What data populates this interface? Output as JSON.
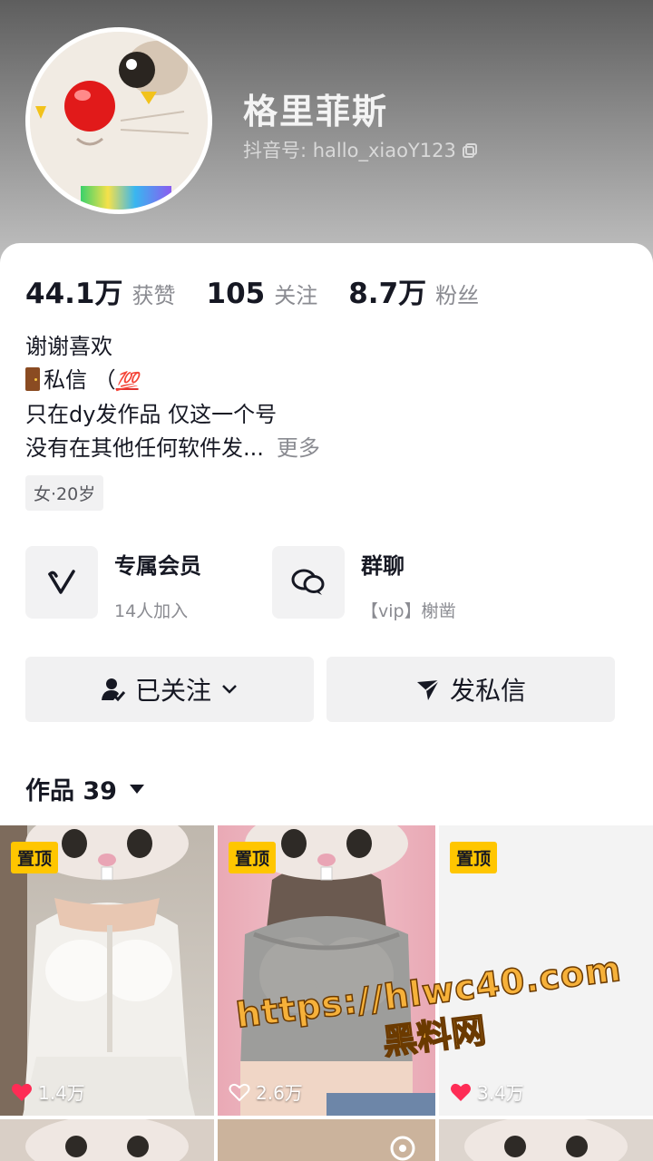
{
  "profile": {
    "nickname": "格里菲斯",
    "douyin_id": "抖音号: hallo_xiaoY123"
  },
  "stats": [
    {
      "value": "44.1万",
      "label": "获赞"
    },
    {
      "value": "105",
      "label": "关注"
    },
    {
      "value": "8.7万",
      "label": "粉丝"
    }
  ],
  "bio": {
    "line1": "谢谢喜欢",
    "line2_text": "私信 （",
    "line2_emoji": "💯",
    "line3": "只在dy发作品  仅这一个号",
    "line4": "没有在其他任何软件发...",
    "more": "更多"
  },
  "tag": "女·20岁",
  "features": [
    {
      "title": "专属会员",
      "sub": "14人加入",
      "icon": "vip-v-icon"
    },
    {
      "title": "群聊",
      "sub": "【vip】榭凿",
      "icon": "chat-bubbles-icon"
    }
  ],
  "buttons": {
    "followed": "已关注",
    "message": "发私信"
  },
  "works": {
    "label": "作品 39"
  },
  "tiles": [
    {
      "pin": "置顶",
      "likes": "1.4万",
      "liked": true
    },
    {
      "pin": "置顶",
      "likes": "2.6万",
      "liked": false
    },
    {
      "pin": "置顶",
      "likes": "3.4万",
      "liked": true
    }
  ],
  "watermark": {
    "url": "https://hlwc40.com",
    "site": "黑料网"
  },
  "colors": {
    "pin": "#ffc600",
    "heart": "#fe2c55",
    "watermark": "#f6b13a"
  }
}
